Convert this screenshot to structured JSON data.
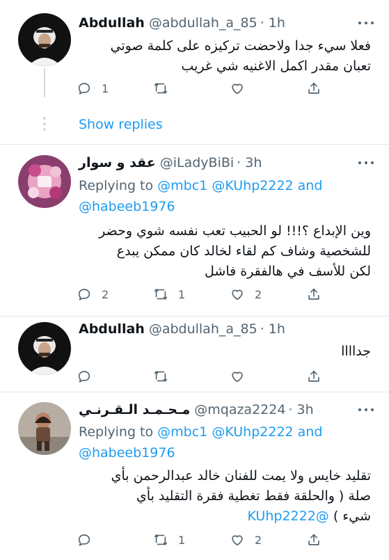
{
  "tweets": [
    {
      "name": "Abdullah",
      "handle": "@abdullah_a_85",
      "time": "· 1h",
      "lines": [
        "فعلا سيء جدا ولاحضت تركيزه على كلمة صوتي",
        "تعبان مقدر اكمل الاغنيه شي غريب"
      ],
      "reply_count": "1",
      "retweet_count": "",
      "like_count": ""
    },
    {
      "name": "عقد و سوار",
      "handle": "@iLadyBiBi",
      "time": "· 3h",
      "replying_label": "Replying to",
      "replying_line1": "@mbc1 @KUhp2222 and",
      "replying_line2": "@habeeb1976",
      "lines": [
        "وين الإبداع ؟!!! لو الحبيب تعب نفسه شوي وحضر",
        "للشخصية وشاف كم لقاء لخالد كان ممكن يبدع",
        "لكن للأسف في هالفقرة فاشل"
      ],
      "reply_count": "2",
      "retweet_count": "1",
      "like_count": "2"
    },
    {
      "name": "Abdullah",
      "handle": "@abdullah_a_85",
      "time": "· 1h",
      "lines": [
        "جداااا"
      ],
      "reply_count": "",
      "retweet_count": "",
      "like_count": ""
    },
    {
      "name": "مـحـمـد الـقـرنـي",
      "handle": "@mqaza2224",
      "time": "· 3h",
      "replying_label": "Replying to",
      "replying_line1": "@mbc1 @KUhp2222 and",
      "replying_line2": "@habeeb1976",
      "lines": [
        "تقليد خايس ولا يمت للفنان خالد عبدالرحمن بأي",
        "صلة ( والحلقة فقط تغطية فقرة التقليد بأي"
      ],
      "last_line_text": "شيء )",
      "last_line_mention": "@KUhp2222",
      "reply_count": "",
      "retweet_count": "1",
      "like_count": "2"
    }
  ],
  "show_replies": "Show replies",
  "icons": {
    "reply": "reply-icon",
    "retweet": "retweet-icon",
    "like": "like-icon",
    "share": "share-icon",
    "more": "more-icon"
  },
  "colors": {
    "link": "#1d9bf0",
    "secondary": "#536471",
    "divider": "#e1e8ed"
  }
}
